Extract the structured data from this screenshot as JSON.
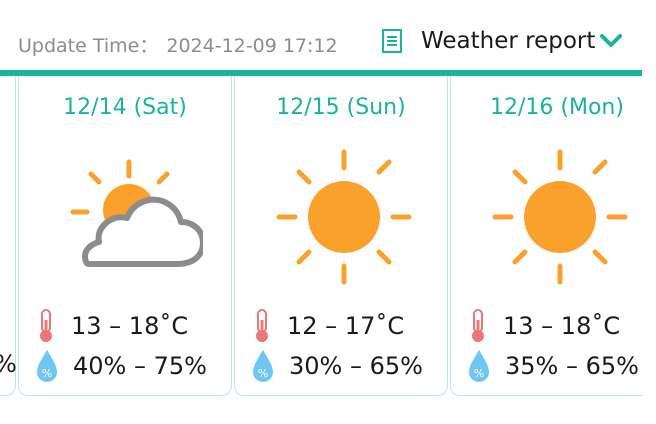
{
  "header": {
    "update_label": "Update Time：",
    "update_time": "2024-12-09 17:12",
    "report_label": "Weather report",
    "report_icon": "document-icon",
    "dropdown_icon": "chevron-down-icon"
  },
  "colors": {
    "accent": "#1ab39b",
    "sun": "#f9a12a",
    "cloud": "#8c8c8c",
    "thermometer": "#e9787a",
    "droplet": "#6fc6f0"
  },
  "forecast": [
    {
      "date": "12/14 (Sat)",
      "condition": "partly-cloudy-icon",
      "temperature": "13 – 18˚C",
      "humidity": "40% – 75%"
    },
    {
      "date": "12/15 (Sun)",
      "condition": "sunny-icon",
      "temperature": "12 – 17˚C",
      "humidity": "30% – 65%"
    },
    {
      "date": "12/16 (Mon)",
      "condition": "sunny-icon",
      "temperature": "13 – 18˚C",
      "humidity": "35% – 65%"
    }
  ],
  "partial_prev_card": {
    "humidity_fragment": "%"
  }
}
